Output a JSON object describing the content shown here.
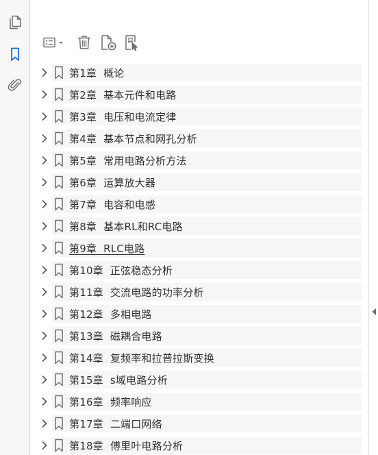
{
  "colors": {
    "accent": "#1473e6",
    "icon_gray": "#6e6e6e",
    "text": "#333333",
    "row_bg": "#f6f6f6"
  },
  "rail": {
    "items": [
      {
        "name": "page-thumbnails",
        "icon": "pages-icon",
        "active": false
      },
      {
        "name": "bookmarks",
        "icon": "bookmark-icon",
        "active": true
      },
      {
        "name": "attachments",
        "icon": "paperclip-icon",
        "active": false
      }
    ]
  },
  "toolbar": {
    "buttons": [
      {
        "name": "options",
        "icon": "list-options-icon"
      },
      {
        "name": "delete",
        "icon": "trash-icon"
      },
      {
        "name": "new-bookmark",
        "icon": "add-bookmark-icon"
      },
      {
        "name": "find-bookmark",
        "icon": "find-bookmark-icon"
      }
    ]
  },
  "bookmarks": [
    {
      "label": "第1章  概论"
    },
    {
      "label": "第2章  基本元件和电路"
    },
    {
      "label": "第3章  电压和电流定律"
    },
    {
      "label": "第4章  基本节点和网孔分析"
    },
    {
      "label": "第5章  常用电路分析方法"
    },
    {
      "label": "第6章  运算放大器"
    },
    {
      "label": "第7章  电容和电感"
    },
    {
      "label": "第8章  基本RL和RC电路"
    },
    {
      "label": "第9章  RLC电路",
      "underlined": true
    },
    {
      "label": "第10章  正弦稳态分析"
    },
    {
      "label": "第11章  交流电路的功率分析"
    },
    {
      "label": "第12章  多相电路"
    },
    {
      "label": "第13章  磁耦合电路"
    },
    {
      "label": "第14章  复频率和拉普拉斯变换"
    },
    {
      "label": "第15章  s域电路分析"
    },
    {
      "label": "第16章  频率响应"
    },
    {
      "label": "第17章  二端口网络"
    },
    {
      "label": "第18章  傅里叶电路分析"
    }
  ]
}
